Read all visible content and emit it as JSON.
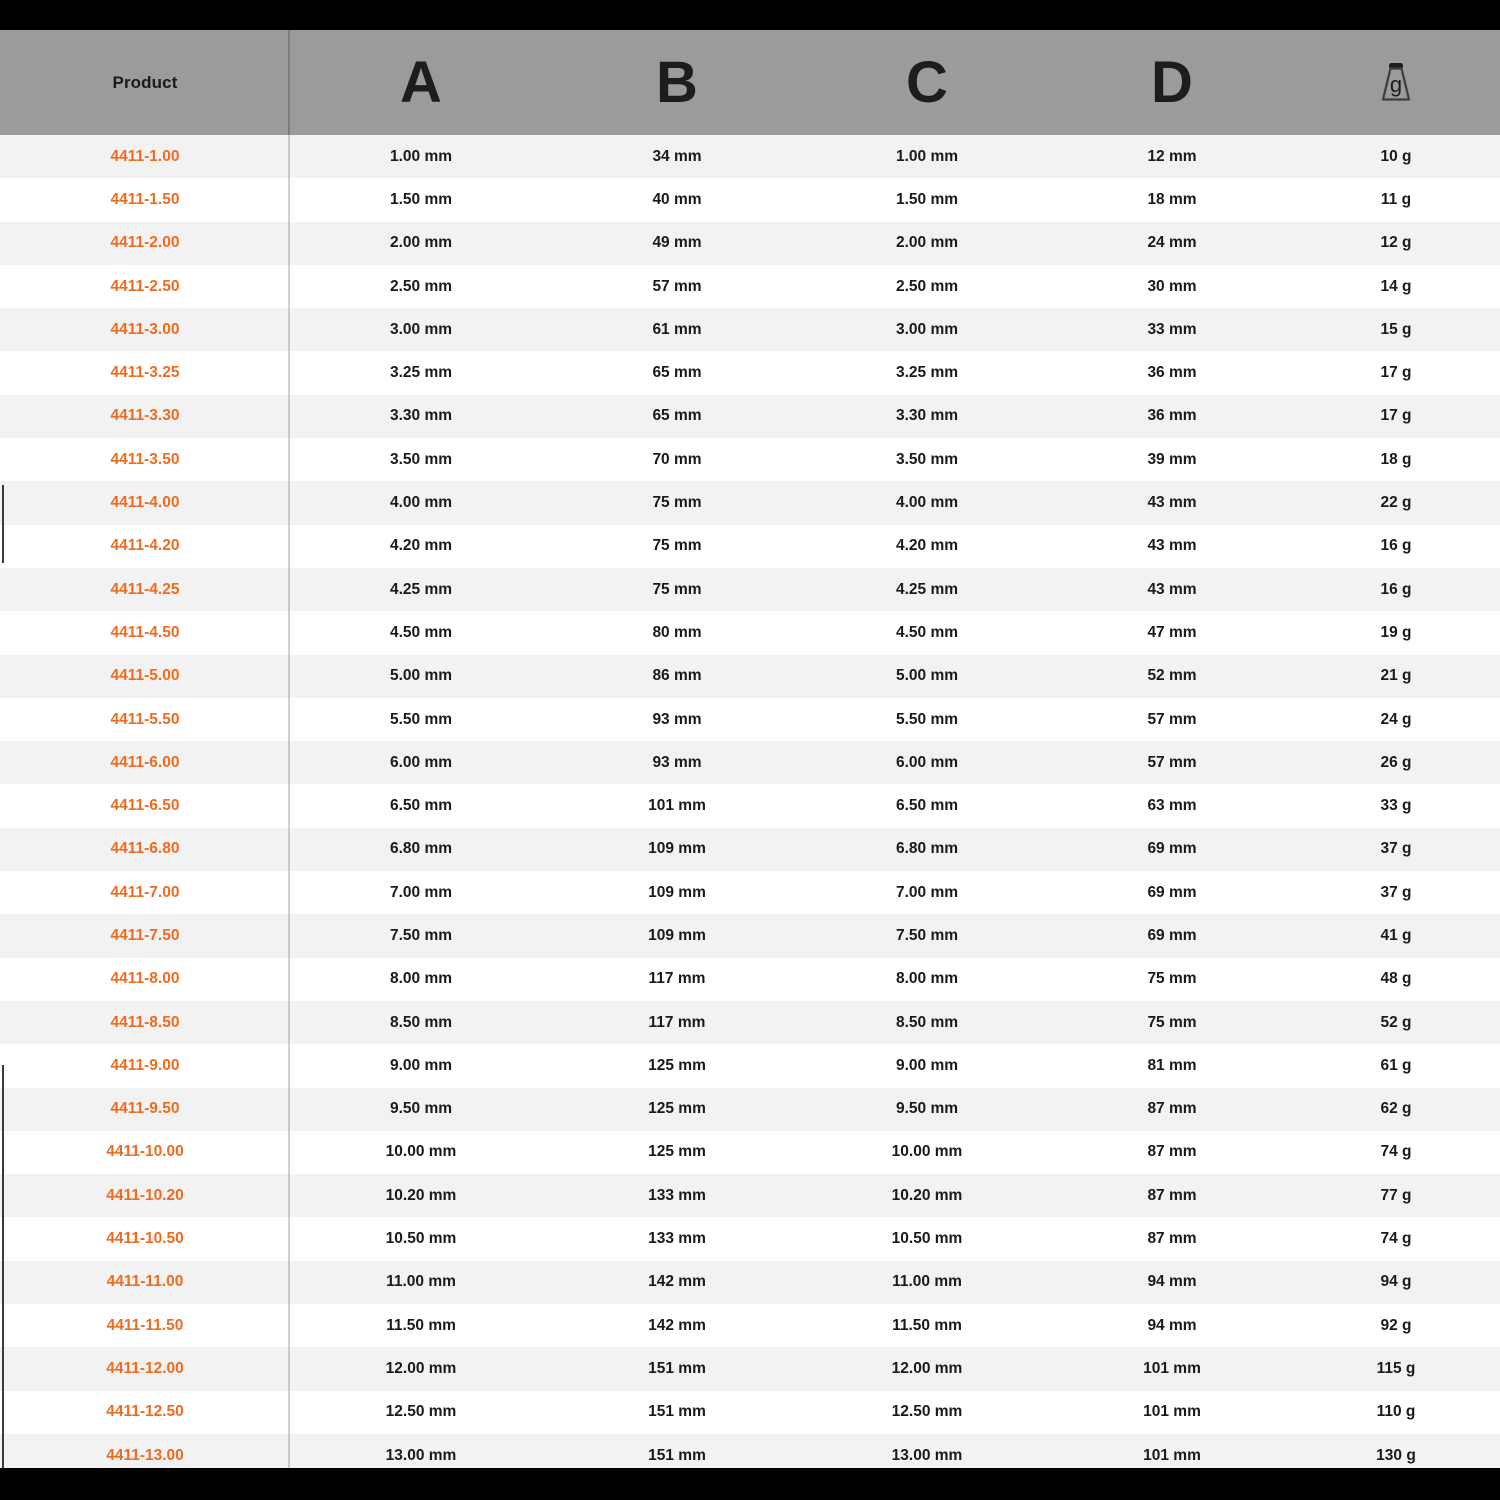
{
  "table": {
    "columns": [
      {
        "key": "product",
        "label": "Product",
        "type": "text"
      },
      {
        "key": "a",
        "label": "A",
        "type": "letter"
      },
      {
        "key": "b",
        "label": "B",
        "type": "letter"
      },
      {
        "key": "c",
        "label": "C",
        "type": "letter"
      },
      {
        "key": "d",
        "label": "D",
        "type": "letter"
      },
      {
        "key": "g",
        "label": "g",
        "type": "icon",
        "icon": "weight-g-icon"
      }
    ],
    "accent_color": "#ee6b1f",
    "header_background": "#9b9b9b",
    "row_alt_background": "#f2f2f2",
    "rows": [
      {
        "product": "4411-1.00",
        "a": "1.00 mm",
        "b": "34 mm",
        "c": "1.00 mm",
        "d": "12 mm",
        "g": "10 g"
      },
      {
        "product": "4411-1.50",
        "a": "1.50 mm",
        "b": "40 mm",
        "c": "1.50 mm",
        "d": "18 mm",
        "g": "11 g"
      },
      {
        "product": "4411-2.00",
        "a": "2.00 mm",
        "b": "49 mm",
        "c": "2.00 mm",
        "d": "24 mm",
        "g": "12 g"
      },
      {
        "product": "4411-2.50",
        "a": "2.50 mm",
        "b": "57 mm",
        "c": "2.50 mm",
        "d": "30 mm",
        "g": "14 g"
      },
      {
        "product": "4411-3.00",
        "a": "3.00 mm",
        "b": "61 mm",
        "c": "3.00 mm",
        "d": "33 mm",
        "g": "15 g"
      },
      {
        "product": "4411-3.25",
        "a": "3.25 mm",
        "b": "65 mm",
        "c": "3.25 mm",
        "d": "36 mm",
        "g": "17 g"
      },
      {
        "product": "4411-3.30",
        "a": "3.30 mm",
        "b": "65 mm",
        "c": "3.30 mm",
        "d": "36 mm",
        "g": "17 g"
      },
      {
        "product": "4411-3.50",
        "a": "3.50 mm",
        "b": "70 mm",
        "c": "3.50 mm",
        "d": "39 mm",
        "g": "18 g"
      },
      {
        "product": "4411-4.00",
        "a": "4.00 mm",
        "b": "75 mm",
        "c": "4.00 mm",
        "d": "43 mm",
        "g": "22 g"
      },
      {
        "product": "4411-4.20",
        "a": "4.20 mm",
        "b": "75 mm",
        "c": "4.20 mm",
        "d": "43 mm",
        "g": "16 g"
      },
      {
        "product": "4411-4.25",
        "a": "4.25 mm",
        "b": "75 mm",
        "c": "4.25 mm",
        "d": "43 mm",
        "g": "16 g"
      },
      {
        "product": "4411-4.50",
        "a": "4.50 mm",
        "b": "80 mm",
        "c": "4.50 mm",
        "d": "47 mm",
        "g": "19 g"
      },
      {
        "product": "4411-5.00",
        "a": "5.00 mm",
        "b": "86 mm",
        "c": "5.00 mm",
        "d": "52 mm",
        "g": "21 g"
      },
      {
        "product": "4411-5.50",
        "a": "5.50 mm",
        "b": "93 mm",
        "c": "5.50 mm",
        "d": "57 mm",
        "g": "24 g"
      },
      {
        "product": "4411-6.00",
        "a": "6.00 mm",
        "b": "93 mm",
        "c": "6.00 mm",
        "d": "57 mm",
        "g": "26 g"
      },
      {
        "product": "4411-6.50",
        "a": "6.50 mm",
        "b": "101 mm",
        "c": "6.50 mm",
        "d": "63 mm",
        "g": "33 g"
      },
      {
        "product": "4411-6.80",
        "a": "6.80 mm",
        "b": "109 mm",
        "c": "6.80 mm",
        "d": "69 mm",
        "g": "37 g"
      },
      {
        "product": "4411-7.00",
        "a": "7.00 mm",
        "b": "109 mm",
        "c": "7.00 mm",
        "d": "69 mm",
        "g": "37 g"
      },
      {
        "product": "4411-7.50",
        "a": "7.50 mm",
        "b": "109 mm",
        "c": "7.50 mm",
        "d": "69 mm",
        "g": "41 g"
      },
      {
        "product": "4411-8.00",
        "a": "8.00 mm",
        "b": "117 mm",
        "c": "8.00 mm",
        "d": "75 mm",
        "g": "48 g"
      },
      {
        "product": "4411-8.50",
        "a": "8.50 mm",
        "b": "117 mm",
        "c": "8.50 mm",
        "d": "75 mm",
        "g": "52 g"
      },
      {
        "product": "4411-9.00",
        "a": "9.00 mm",
        "b": "125 mm",
        "c": "9.00 mm",
        "d": "81 mm",
        "g": "61 g"
      },
      {
        "product": "4411-9.50",
        "a": "9.50 mm",
        "b": "125 mm",
        "c": "9.50 mm",
        "d": "87 mm",
        "g": "62 g"
      },
      {
        "product": "4411-10.00",
        "a": "10.00 mm",
        "b": "125 mm",
        "c": "10.00 mm",
        "d": "87 mm",
        "g": "74 g"
      },
      {
        "product": "4411-10.20",
        "a": "10.20 mm",
        "b": "133 mm",
        "c": "10.20 mm",
        "d": "87 mm",
        "g": "77 g"
      },
      {
        "product": "4411-10.50",
        "a": "10.50 mm",
        "b": "133 mm",
        "c": "10.50 mm",
        "d": "87 mm",
        "g": "74 g"
      },
      {
        "product": "4411-11.00",
        "a": "11.00 mm",
        "b": "142 mm",
        "c": "11.00 mm",
        "d": "94 mm",
        "g": "94 g"
      },
      {
        "product": "4411-11.50",
        "a": "11.50 mm",
        "b": "142 mm",
        "c": "11.50 mm",
        "d": "94 mm",
        "g": "92 g"
      },
      {
        "product": "4411-12.00",
        "a": "12.00 mm",
        "b": "151 mm",
        "c": "12.00 mm",
        "d": "101 mm",
        "g": "115 g"
      },
      {
        "product": "4411-12.50",
        "a": "12.50 mm",
        "b": "151 mm",
        "c": "12.50 mm",
        "d": "101 mm",
        "g": "110 g"
      },
      {
        "product": "4411-13.00",
        "a": "13.00 mm",
        "b": "151 mm",
        "c": "13.00 mm",
        "d": "101 mm",
        "g": "130 g"
      }
    ]
  }
}
